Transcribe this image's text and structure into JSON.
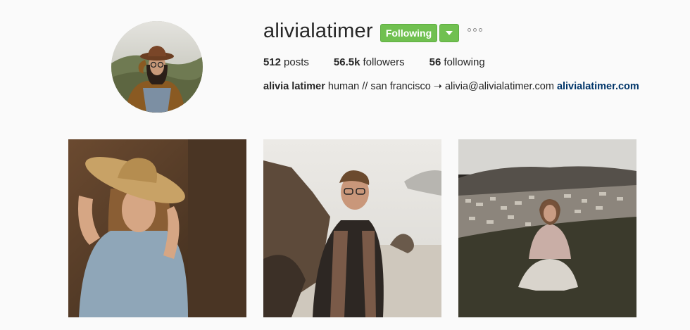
{
  "profile": {
    "username": "alivialatimer",
    "follow_label": "Following",
    "stats": {
      "posts_count": "512",
      "posts_label": "posts",
      "followers_count": "56.5k",
      "followers_label": "followers",
      "following_count": "56",
      "following_label": "following"
    },
    "bio": {
      "full_name": "alivia latimer",
      "text": " human // san francisco ➝ alivia@alivialatimer.com ",
      "website": "alivialatimer.com"
    }
  },
  "colors": {
    "follow_button": "#70c050",
    "link": "#003569",
    "background": "#fafafa"
  },
  "icons": {
    "dropdown": "caret-down-icon",
    "more": "more-options-icon"
  }
}
